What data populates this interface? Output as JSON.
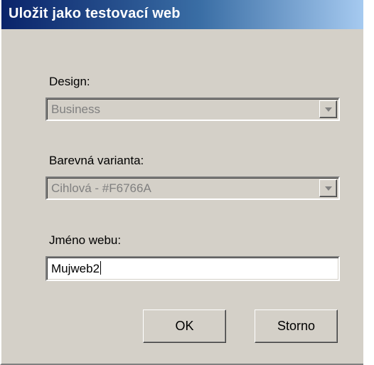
{
  "window": {
    "title": "Uložit jako testovací web"
  },
  "design": {
    "label": "Design:",
    "value": "Business",
    "enabled": false
  },
  "color_variant": {
    "label": "Barevná varianta:",
    "value": "Cihlová - #F6766A",
    "enabled": false
  },
  "web_name": {
    "label": "Jméno webu:",
    "value": "Mujweb2"
  },
  "buttons": {
    "ok_label": "OK",
    "cancel_label": "Storno"
  },
  "colors": {
    "titlebar_start": "#0a246a",
    "titlebar_end": "#a6caf0",
    "dialog_face": "#d4d0c8",
    "disabled_text": "#808080"
  },
  "icons": {
    "dropdown": "chevron-down-icon"
  }
}
